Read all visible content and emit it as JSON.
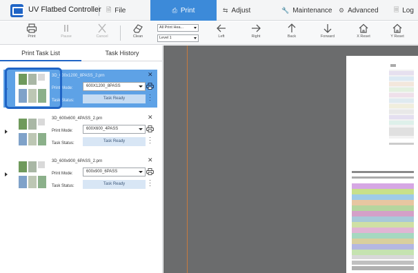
{
  "app": {
    "title": "UV Flatbed Controller"
  },
  "menu": {
    "items": [
      {
        "label": "File",
        "icon": "file-icon"
      },
      {
        "label": "Print",
        "icon": "print-icon",
        "active": true
      },
      {
        "label": "Adjust",
        "icon": "adjust-icon"
      },
      {
        "label": "Maintenance",
        "icon": "maintenance-icon"
      },
      {
        "label": "Advanced",
        "icon": "advanced-icon"
      },
      {
        "label": "Log",
        "icon": "log-icon"
      }
    ]
  },
  "toolbar": {
    "print_label": "Print",
    "pause_label": "Pause",
    "cancel_label": "Cancel",
    "clean_label": "Clean",
    "print_head_select": "All Print Hea...",
    "level_select": "Level 1",
    "left_label": "Left",
    "right_label": "Right",
    "back_label": "Back",
    "forward_label": "Forward",
    "x_reset_label": "X Reset",
    "y_reset_label": "Y Reset"
  },
  "tabs": {
    "task_list": "Print Task List",
    "task_history": "Task History"
  },
  "task_labels": {
    "print_mode": "Print Mode:",
    "task_status": "Task Status:"
  },
  "tasks": [
    {
      "name": "3D_600x1200_8PASS_2.prn",
      "mode": "600X1200_8PASS",
      "status": "Task Ready",
      "selected": true
    },
    {
      "name": "3D_600x600_4PASS_2.prn",
      "mode": "600X600_4PASS",
      "status": "Task Ready",
      "selected": false
    },
    {
      "name": "3D_600x900_6PASS_2.prn",
      "mode": "600x900_6PASS",
      "status": "Task Ready",
      "selected": false
    }
  ],
  "colors": {
    "accent": "#1f64c5",
    "menu_active": "#3c8ad9",
    "selected_task": "#5ea2e6",
    "canvas": "#6b6c6d"
  }
}
